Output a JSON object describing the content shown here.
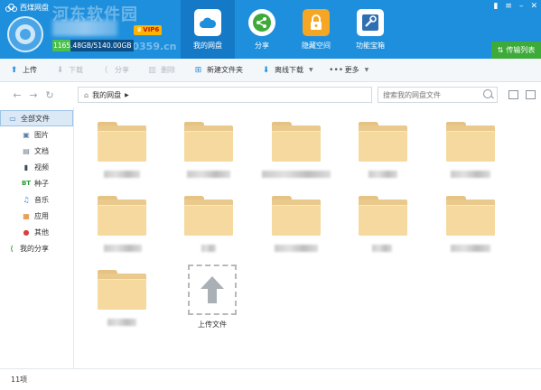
{
  "app": {
    "title": "西煤网盘"
  },
  "user": {
    "storage_text": "1165.48GB/5140.00GB",
    "storage_used_fraction": 0.227,
    "vip_label": "VIP6"
  },
  "watermark": {
    "text": "河东软件园",
    "url": "www.pc0359.cn"
  },
  "nav": [
    {
      "label": "我的网盘",
      "icon": "cloud-icon",
      "active": true
    },
    {
      "label": "分享",
      "icon": "share-icon"
    },
    {
      "label": "隐藏空间",
      "icon": "lock-icon"
    },
    {
      "label": "功能宝箱",
      "icon": "toolbox-icon"
    }
  ],
  "transfer": {
    "label": "传输列表"
  },
  "toolbar": {
    "upload": "上传",
    "download": "下载",
    "share": "分享",
    "delete": "删除",
    "new_folder": "新建文件夹",
    "offline": "离线下载",
    "more": "更多"
  },
  "address": {
    "path": "我的网盘",
    "search_placeholder": "搜索我的网盘文件"
  },
  "sidebar": {
    "root": "全部文件",
    "items": [
      {
        "label": "图片",
        "icon": "image-icon",
        "color": "#5b7fa6"
      },
      {
        "label": "文档",
        "icon": "document-icon",
        "color": "#6c7a89"
      },
      {
        "label": "视频",
        "icon": "video-icon",
        "color": "#3a4b5c"
      },
      {
        "label": "种子",
        "icon": "torrent-icon",
        "color": "#2a9a3a"
      },
      {
        "label": "音乐",
        "icon": "music-icon",
        "color": "#2b88d8"
      },
      {
        "label": "应用",
        "icon": "apps-icon",
        "color": "#e07b1a"
      },
      {
        "label": "其他",
        "icon": "other-icon",
        "color": "#d94040"
      }
    ],
    "share": "我的分享"
  },
  "content": {
    "upload_label": "上传文件"
  },
  "status": {
    "count": "11项"
  },
  "colors": {
    "header": "#1e8fdc",
    "header_active": "#1479c6",
    "green": "#3daa3a",
    "folder": "#f6d99e"
  }
}
